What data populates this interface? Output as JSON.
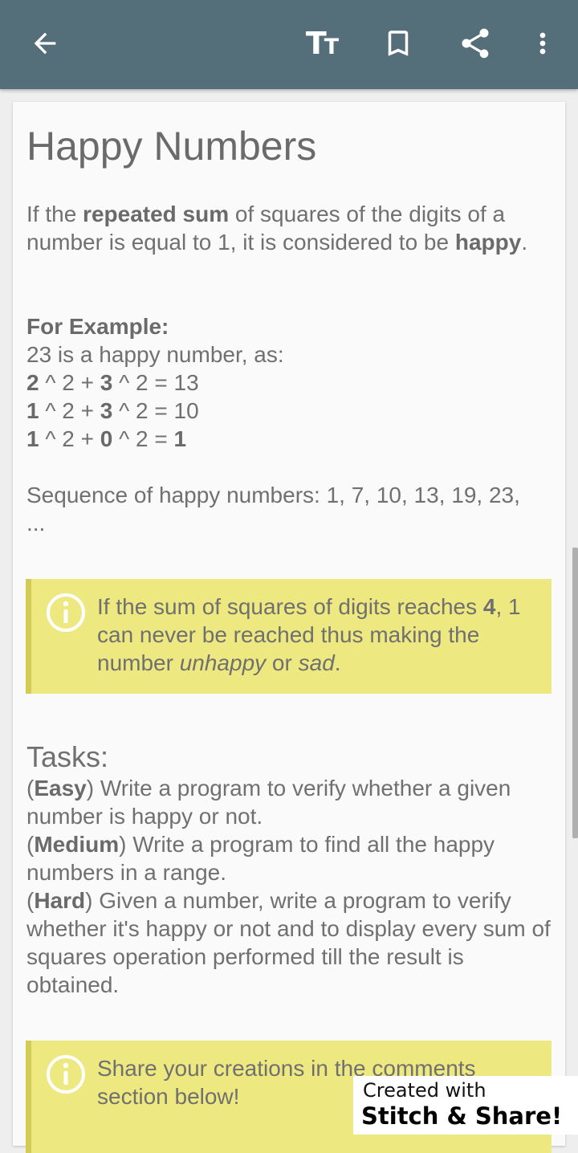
{
  "toolbar": {
    "background": "#546e7a",
    "icons": [
      "arrow-back-icon",
      "text-size-icon",
      "bookmark-icon",
      "share-icon",
      "more-vert-icon"
    ],
    "text_size_glyph": "T",
    "text_size_glyph_small": "T"
  },
  "article": {
    "title": "Happy Numbers",
    "intro": {
      "t1": "If the ",
      "b1": "repeated sum",
      "t2": " of squares of the digits of a number is equal to 1, it is considered to be ",
      "b2": "happy",
      "t3": "."
    },
    "example": {
      "heading": "For Example:",
      "line": "23 is a happy number, as:",
      "steps": [
        {
          "a": "2",
          "op1": " ^ 2 + ",
          "b": "3",
          "op2": " ^ 2 = 13"
        },
        {
          "a": "1",
          "op1": " ^ 2 + ",
          "b": "3",
          "op2": " ^ 2 = 10"
        },
        {
          "a": "1",
          "op1": " ^ 2 + ",
          "b": "0",
          "op2": " ^ 2 = ",
          "res": "1"
        }
      ]
    },
    "sequence": "Sequence of happy numbers: 1, 7, 10, 13, 19, 23, ...",
    "note1": {
      "t1": "If the sum of squares of digits reaches ",
      "b1": "4",
      "t2": ", 1 can never be reached thus making the number ",
      "i1": "unhappy",
      "t3": " or ",
      "i2": "sad",
      "t4": "."
    },
    "tasks": {
      "heading": "Tasks:",
      "items": [
        {
          "open": "(",
          "level": "Easy",
          "close": ")",
          "text": " Write a program to verify whether a given number is happy or not."
        },
        {
          "open": "(",
          "level": "Medium",
          "close": ")",
          "text": " Write a program to find all the happy numbers in a range."
        },
        {
          "open": "(",
          "level": "Hard",
          "close": ")",
          "text": " Given a number, write a program to verify whether it's happy or not and to display every sum of squares operation performed till the result is obtained."
        }
      ]
    },
    "note2": "Share your creations in the comments section below!",
    "note_icon": "info-icon",
    "note_bg": "#eee880",
    "note_border": "#d2cc55"
  },
  "watermark": {
    "line1": "Created with",
    "line2": "Stitch & Share!"
  }
}
